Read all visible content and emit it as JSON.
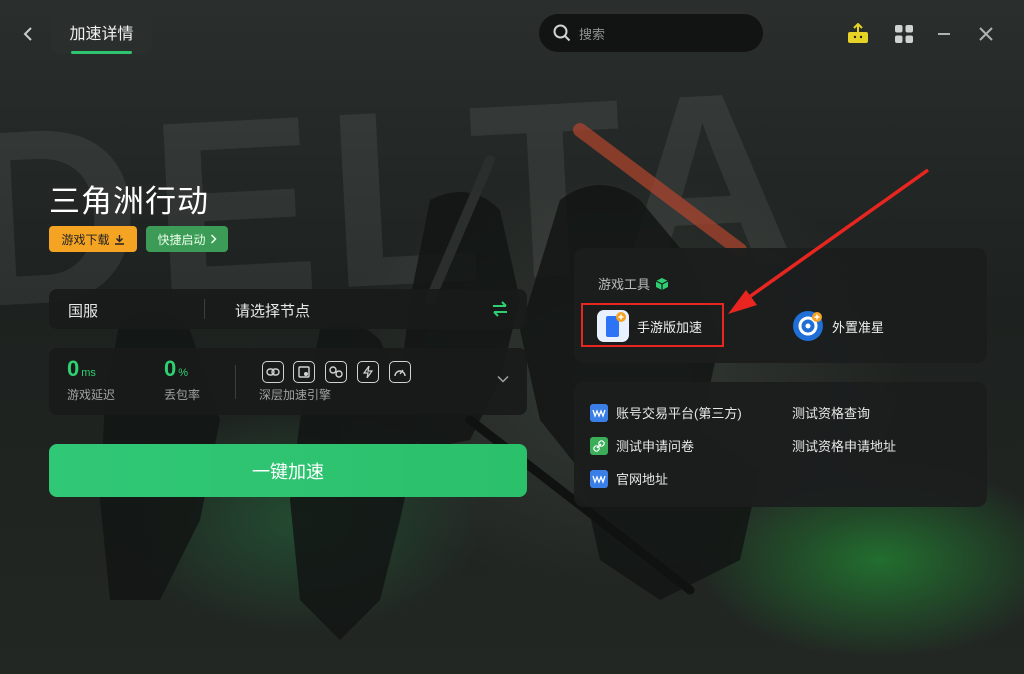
{
  "header": {
    "back_label": "back",
    "active_tab": "加速详情",
    "search_placeholder": "搜索"
  },
  "background": {
    "watermark": "DELTA"
  },
  "game": {
    "title": "三角洲行动",
    "download_label": "游戏下载",
    "quick_launch_label": "快捷启动"
  },
  "region_bar": {
    "region": "国服",
    "node_placeholder": "请选择节点"
  },
  "stats": {
    "latency_value": "0",
    "latency_unit": "ms",
    "latency_label": "游戏延迟",
    "loss_value": "0",
    "loss_unit": "%",
    "loss_label": "丢包率",
    "engine_label": "深层加速引擎",
    "engine_icons": [
      "link-icon",
      "screen-icon",
      "share-icon",
      "bolt-icon",
      "gauge-icon"
    ]
  },
  "accelerate_button": "一键加速",
  "tools": {
    "title": "游戏工具",
    "items": [
      {
        "label": "手游版加速",
        "icon": "phone-icon"
      },
      {
        "label": "外置准星",
        "icon": "crosshair-icon"
      }
    ]
  },
  "links": [
    {
      "label": "账号交易平台(第三方)",
      "icon": "www-icon"
    },
    {
      "label": "测试资格查询",
      "icon": ""
    },
    {
      "label": "测试申请问卷",
      "icon": "link-icon"
    },
    {
      "label": "测试资格申请地址",
      "icon": ""
    },
    {
      "label": "官网地址",
      "icon": "www-icon"
    }
  ],
  "colors": {
    "accent_green": "#2fd071",
    "download_orange": "#f4a323",
    "highlight_red": "#e8261f"
  }
}
